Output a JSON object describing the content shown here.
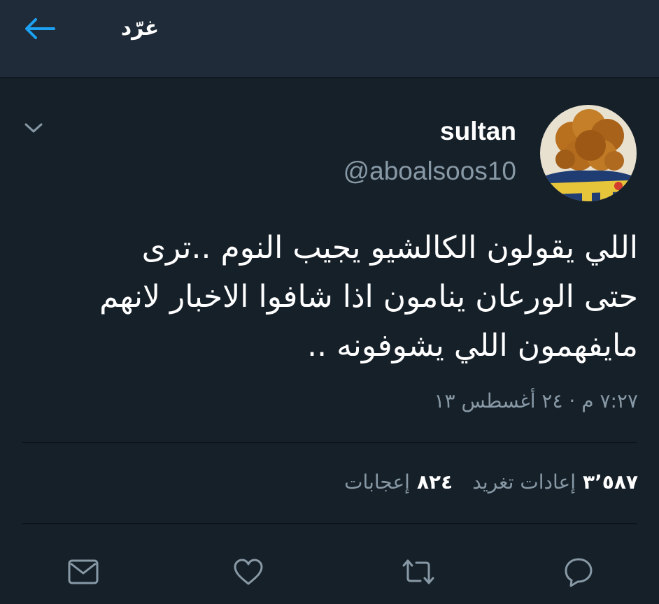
{
  "header": {
    "title": "غرّد",
    "back_icon": "arrow-left-icon"
  },
  "tweet": {
    "author": {
      "display_name": "sultan",
      "handle": "@aboalsoos10"
    },
    "text_lines": [
      "اللي يقولون الكالشيو يجيب النوم ..ترى",
      "حتى الورعان ينامون اذا شافوا الاخبار لانهم",
      "مايفهمون اللي يشوفونه .."
    ],
    "timestamp": "٧:٢٧ م · ٢٤ أغسطس ١٣",
    "stats": {
      "retweets_count": "٣٬٥٨٧",
      "retweets_label": "إعادات تغريد",
      "likes_count": "٨٢٤",
      "likes_label": "إعجابات"
    }
  },
  "actions": [
    "reply-icon",
    "retweet-icon",
    "like-icon",
    "direct-message-icon"
  ],
  "colors": {
    "background": "#162029",
    "header_background": "#1f2b38",
    "accent": "#1da1f2",
    "secondary_text": "#8899a6",
    "icon": "#8899a6"
  }
}
